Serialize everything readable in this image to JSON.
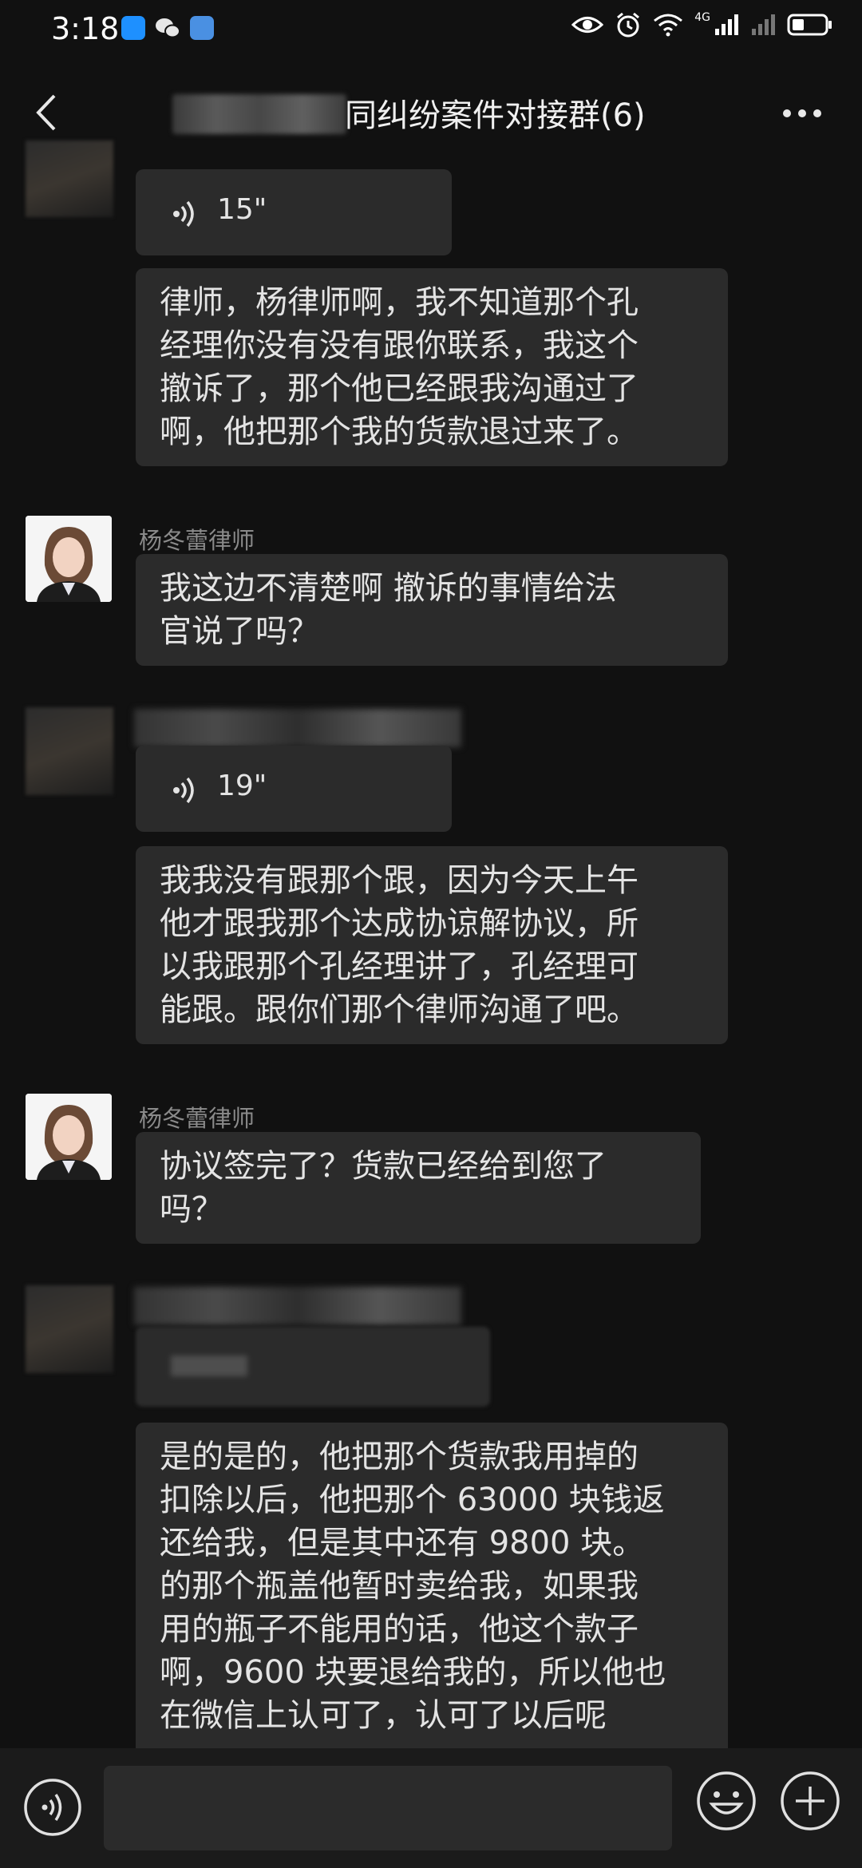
{
  "status_bar": {
    "time": "3:18",
    "network": "4G"
  },
  "header": {
    "title": "同纠纷案件对接群(6)"
  },
  "messages": [
    {
      "type": "voice",
      "duration": "15\""
    },
    {
      "type": "text",
      "lines": [
        "律师，杨律师啊，我不知道那个孔",
        "经理你没有没有跟你联系，我这个",
        "撤诉了，那个他已经跟我沟通过了",
        "啊，他把那个我的货款退过来了。"
      ]
    },
    {
      "type": "text",
      "sender": "杨冬蕾律师",
      "lines": [
        "我这边不清楚啊 撤诉的事情给法",
        "官说了吗？"
      ]
    },
    {
      "type": "voice",
      "duration": "19\""
    },
    {
      "type": "text",
      "lines": [
        "我我没有跟那个跟，因为今天上午",
        "他才跟我那个达成协谅解协议，所",
        "以我跟那个孔经理讲了，孔经理可",
        "能跟。跟你们那个律师沟通了吧。"
      ]
    },
    {
      "type": "text",
      "sender": "杨冬蕾律师",
      "lines": [
        "协议签完了？货款已经给到您了",
        "吗？"
      ]
    },
    {
      "type": "text",
      "lines": [
        "是的是的，他把那个货款我用掉的",
        "扣除以后，他把那个 63000 块钱返",
        "还给我，但是其中还有 9800 块。",
        "的那个瓶盖他暂时卖给我，如果我",
        "用的瓶子不能用的话，他这个款子",
        "啊，9600 块要退给我的，所以他也",
        "在微信上认可了，认可了以后呢"
      ]
    }
  ],
  "icons": {
    "back": "chevron-left-icon",
    "more": "more-dots-icon",
    "voice_mode": "voice-input-icon",
    "emoji": "emoji-icon",
    "plus": "plus-icon"
  },
  "colors": {
    "background": "#111111",
    "bubble": "#2b2b2b",
    "text": "#e4e4e4",
    "sender": "#8a8a8a"
  }
}
